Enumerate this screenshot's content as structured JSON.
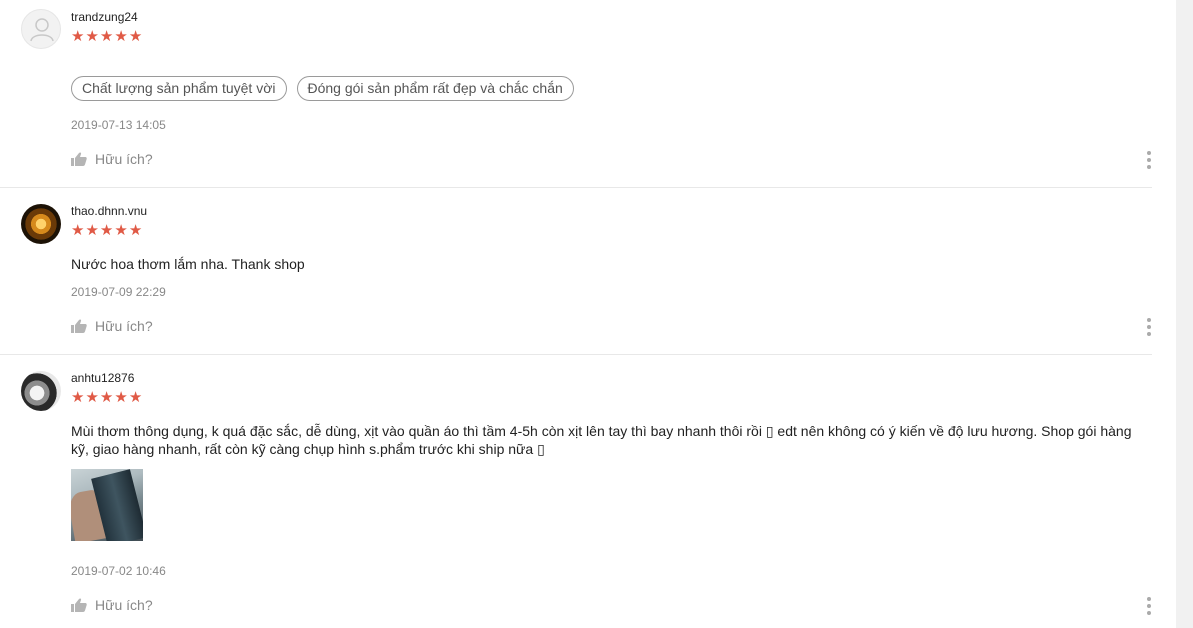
{
  "reviews": [
    {
      "username": "trandzung24",
      "rating": 5,
      "avatar": "default-user-icon",
      "tags": [
        "Chất lượng sản phẩm tuyệt vời",
        "Đóng gói sản phẩm rất đẹp và chắc chắn"
      ],
      "comment": "",
      "date": "2019-07-13 14:05",
      "helpful_label": "Hữu ích?"
    },
    {
      "username": "thao.dhnn.vnu",
      "rating": 5,
      "avatar": "flower-avatar",
      "tags": [],
      "comment": "Nước hoa thơm lắm nha. Thank shop",
      "date": "2019-07-09 22:29",
      "helpful_label": "Hữu ích?"
    },
    {
      "username": "anhtu12876",
      "rating": 5,
      "avatar": "cat-avatar",
      "tags": [],
      "comment": "Mùi thơm thông dụng, k quá đặc sắc, dễ dùng, xịt vào quần áo thì tầm 4-5h còn xịt lên tay thì bay nhanh thôi rồi ▯ edt nên không có ý kiến về độ lưu hương. Shop gói hàng kỹ, giao hàng nhanh, rất còn kỹ càng chụp hình s.phẩm trước khi ship nữa ▯",
      "date": "2019-07-02 10:46",
      "helpful_label": "Hữu ích?"
    }
  ],
  "colors": {
    "star": "#e05a46",
    "muted": "#888888",
    "divider": "#e8e8e8"
  }
}
